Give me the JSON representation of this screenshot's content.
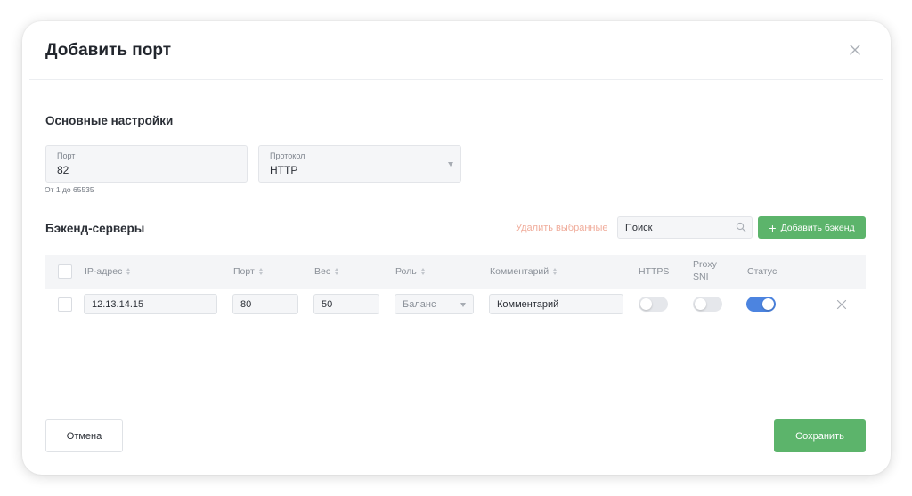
{
  "modal": {
    "title": "Добавить порт",
    "close_icon": "close-icon"
  },
  "basic_settings": {
    "title": "Основные настройки",
    "port": {
      "label": "Порт",
      "value": "82",
      "hint": "От 1 до 65535"
    },
    "protocol": {
      "label": "Протокол",
      "value": "HTTP",
      "icon": "chevron-down-icon"
    }
  },
  "backends": {
    "title": "Бэкенд-серверы",
    "delete_selected": "Удалить выбранные",
    "search_placeholder": "Поиск",
    "search_icon": "search-icon",
    "add_button": "Добавить бэкенд",
    "columns": {
      "ip": "IP-адрес",
      "port": "Порт",
      "weight": "Вес",
      "role": "Роль",
      "comment": "Комментарий",
      "https": "HTTPS",
      "proxy_sni_1": "Proxy",
      "proxy_sni_2": "SNI",
      "status": "Статус"
    },
    "rows": [
      {
        "ip": "12.13.14.15",
        "port": "80",
        "weight": "50",
        "role": "Баланс",
        "comment": "Комментарий",
        "https": false,
        "proxy_sni": false,
        "status": true,
        "checked": false
      }
    ]
  },
  "footer": {
    "cancel": "Отмена",
    "save": "Сохранить"
  },
  "colors": {
    "accent_green": "#5cb46b",
    "toggle_on": "#4c84e0",
    "danger_link": "#f0ad9c"
  }
}
